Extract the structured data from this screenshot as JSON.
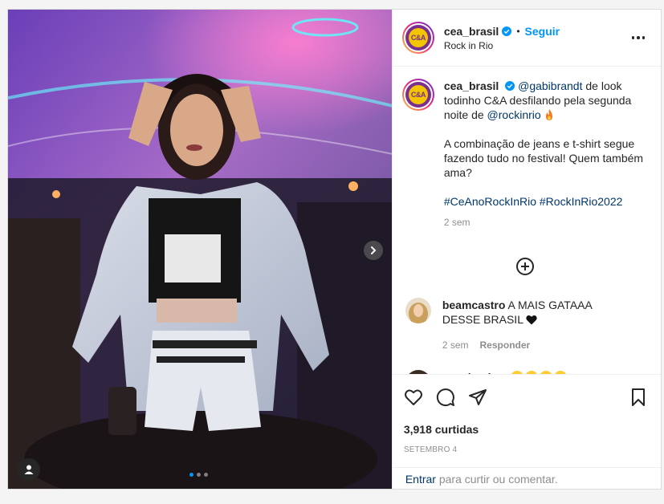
{
  "post": {
    "username": "cea_brasil",
    "follow_label": "Seguir",
    "separator": "•",
    "location": "Rock in Rio",
    "avatar_text": "C&A"
  },
  "caption": {
    "username": "cea_brasil",
    "mention1": "@gabibrandt",
    "text1": " de look todinho C&A desfilando pela segunda noite de ",
    "mention2": "@rockinrio",
    "text2": "A combinação de jeans e t-shirt segue fazendo tudo no festival! Quem também ama?",
    "hashtags": "#CeAnoRockInRio #RockInRio2022",
    "time": "2 sem"
  },
  "comments": [
    {
      "username": "beamcastro",
      "text": " A MAIS GATAAA DESSE BRASIL ",
      "time": "2 sem",
      "reply_label": "Responder"
    },
    {
      "username": "naychapine",
      "text": ""
    }
  ],
  "likes": "3,918 curtidas",
  "date": "SETEMBRO 4",
  "add_comment": {
    "enter_label": "Entrar",
    "hint": " para curtir ou comentar."
  },
  "colors": {
    "accent": "#0095f6",
    "link": "#00376b",
    "muted": "#8e8e8e"
  },
  "icons": [
    "verified-badge-icon",
    "more-icon",
    "chevron-right-icon",
    "user-tag-icon",
    "add-circle-icon",
    "heart-icon",
    "comment-icon",
    "share-icon",
    "bookmark-icon"
  ],
  "carousel": {
    "total": 3,
    "active": 1
  }
}
